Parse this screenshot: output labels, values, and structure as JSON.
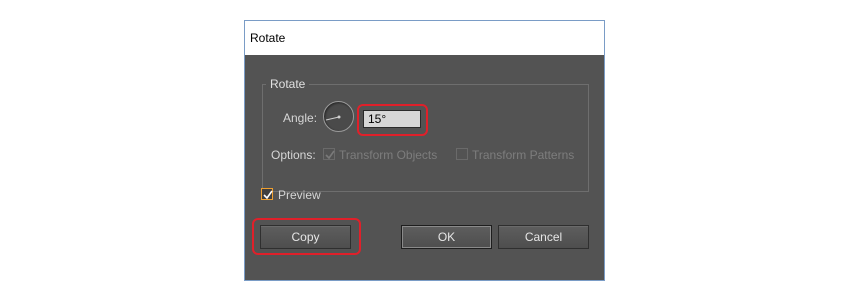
{
  "dialog": {
    "title": "Rotate",
    "group_label": "Rotate",
    "angle_label": "Angle:",
    "angle_value": "15°",
    "options_label": "Options:",
    "transform_objects_label": "Transform Objects",
    "transform_objects_checked": true,
    "transform_patterns_label": "Transform Patterns",
    "transform_patterns_checked": false,
    "preview_label": "Preview",
    "preview_checked": true,
    "copy_label": "Copy",
    "ok_label": "OK",
    "cancel_label": "Cancel"
  },
  "colors": {
    "highlight": "#e0202a",
    "dialog_bg": "#535353",
    "accent_checkbox": "#f0a030"
  }
}
